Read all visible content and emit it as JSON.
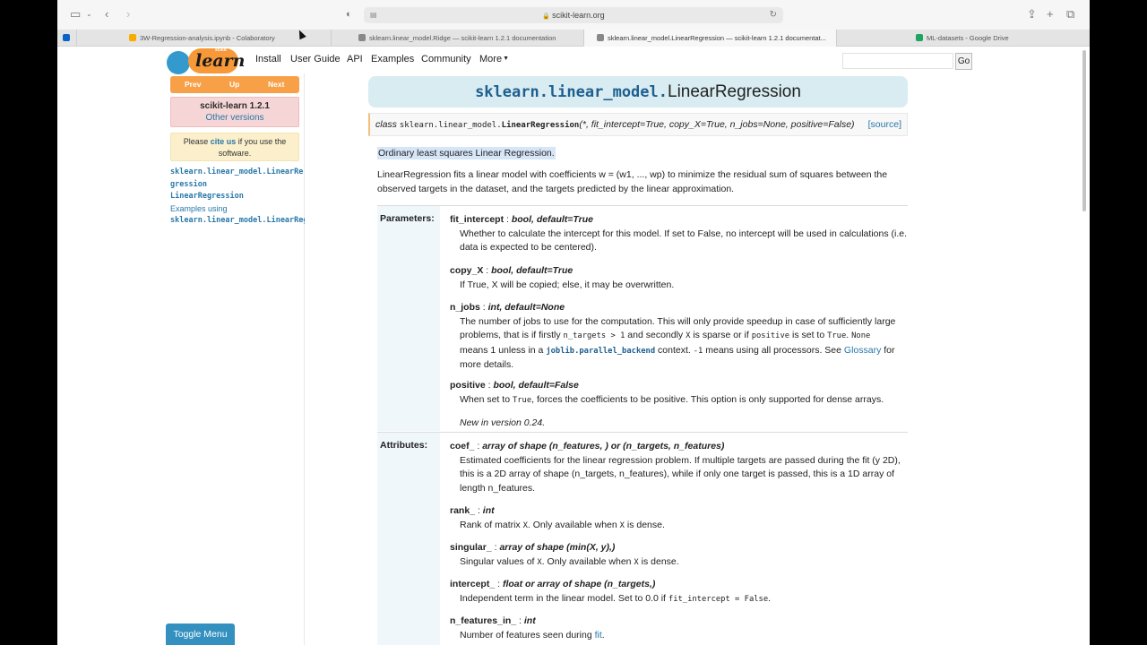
{
  "browser": {
    "url": "scikit-learn.org",
    "tabs": [
      {
        "label": "3W-Regression-analysis.ipynb - Colaboratory",
        "favicon_color": "#f9ab00"
      },
      {
        "label": "sklearn.linear_model.Ridge — scikit-learn 1.2.1 documentation",
        "favicon_color": "#888888"
      },
      {
        "label": "sklearn.linear_model.LinearRegression — scikit-learn 1.2.1 documentat...",
        "favicon_color": "#888888"
      },
      {
        "label": "ML-datasets - Google Drive",
        "favicon_color": "#1fa463"
      }
    ]
  },
  "navbar": {
    "logo_word": "learn",
    "logo_sub": "scikit",
    "links": [
      "Install",
      "User Guide",
      "API",
      "Examples",
      "Community",
      "More"
    ],
    "search_placeholder": "",
    "go_label": "Go"
  },
  "sidebar": {
    "prev": "Prev",
    "up": "Up",
    "next": "Next",
    "version": "scikit-learn 1.2.1",
    "other_versions": "Other versions",
    "cite_pre": "Please ",
    "cite_link": "cite us",
    "cite_post": " if you use the software.",
    "toc": {
      "item1_line1": "sklearn.linear_model.LinearRe",
      "item1_line2": "gression",
      "item2": "LinearRegression",
      "item3": "Examples using",
      "item4": "sklearn.linear_model.LinearRegression"
    },
    "toggle_menu": "Toggle Menu"
  },
  "main": {
    "title_module": "sklearn.linear_model.",
    "title_class": "LinearRegression",
    "signature": {
      "keyword": "class",
      "module": "sklearn.linear_model.",
      "name": "LinearRegression",
      "params": "(*, fit_intercept=True, copy_X=True, n_jobs=None, positive=False)",
      "source": "[source]"
    },
    "short_desc": "Ordinary least squares Linear Regression.",
    "long_desc": "LinearRegression fits a linear model with coefficients w = (w1, ..., wp) to minimize the residual sum of squares between the observed targets in the dataset, and the targets predicted by the linear approximation.",
    "parameters_label": "Parameters:",
    "attributes_label": "Attributes:",
    "params": {
      "fit_intercept": {
        "name": "fit_intercept",
        "type": "bool, default=True",
        "desc": "Whether to calculate the intercept for this model. If set to False, no intercept will be used in calculations (i.e. data is expected to be centered)."
      },
      "copy_X": {
        "name": "copy_X",
        "type": "bool, default=True",
        "desc": "If True, X will be copied; else, it may be overwritten."
      },
      "n_jobs": {
        "name": "n_jobs",
        "type": "int, default=None",
        "desc_1": "The number of jobs to use for the computation. This will only provide speedup in case of sufficiently large problems, that is if firstly ",
        "code_1": "n_targets > 1",
        "desc_2": " and secondly ",
        "code_2": "X",
        "desc_3": " is sparse or if ",
        "code_3": "positive",
        "desc_4": " is set to ",
        "code_4": "True",
        "desc_5": ". ",
        "code_5": "None",
        "desc_6": " means 1 unless in a ",
        "code_6": "joblib.parallel_backend",
        "desc_7": " context. ",
        "code_7": "-1",
        "desc_8": " means using all processors. See ",
        "link": "Glossary",
        "desc_9": " for more details."
      },
      "positive": {
        "name": "positive",
        "type": "bool, default=False",
        "desc_1": "When set to ",
        "code_1": "True",
        "desc_2": ", forces the coefficients to be positive. This option is only supported for dense arrays.",
        "version_note": "New in version 0.24."
      }
    },
    "attributes": {
      "coef": {
        "name": "coef_",
        "type": "array of shape (n_features, ) or (n_targets, n_features)",
        "desc": "Estimated coefficients for the linear regression problem. If multiple targets are passed during the fit (y 2D), this is a 2D array of shape (n_targets, n_features), while if only one target is passed, this is a 1D array of length n_features."
      },
      "rank": {
        "name": "rank_",
        "type": "int",
        "desc_1": "Rank of matrix ",
        "code_1": "X",
        "desc_2": ". Only available when ",
        "code_2": "X",
        "desc_3": " is dense."
      },
      "singular": {
        "name": "singular_",
        "type": "array of shape (min(X, y),)",
        "desc_1": "Singular values of ",
        "code_1": "X",
        "desc_2": ". Only available when ",
        "code_2": "X",
        "desc_3": " is dense."
      },
      "intercept": {
        "name": "intercept_",
        "type": "float or array of shape (n_targets,)",
        "desc_1": "Independent term in the linear model. Set to 0.0 if ",
        "code_1": "fit_intercept = False",
        "desc_2": "."
      },
      "n_features_in": {
        "name": "n_features_in_",
        "type": "int",
        "desc_1": "Number of features seen during ",
        "link": "fit",
        "desc_2": "."
      }
    }
  }
}
